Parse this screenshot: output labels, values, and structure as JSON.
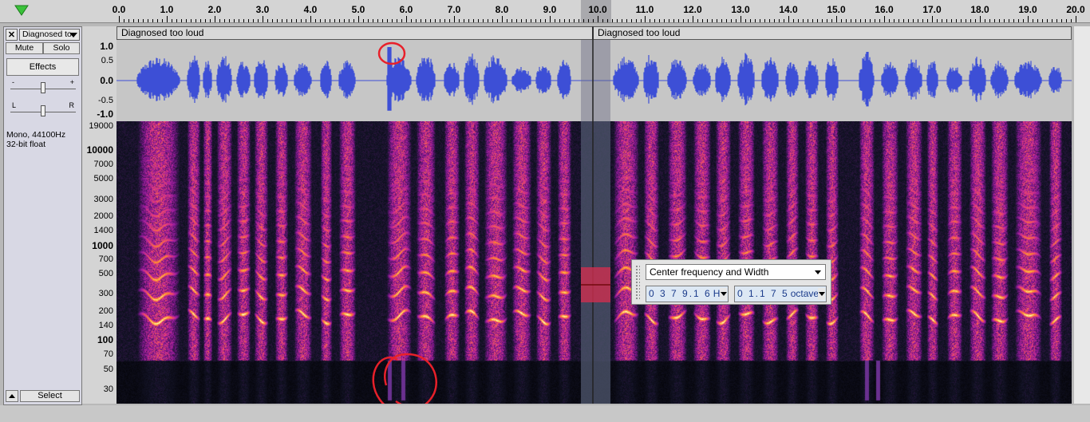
{
  "ruler": {
    "labels": [
      "0.0",
      "1.0",
      "2.0",
      "3.0",
      "4.0",
      "5.0",
      "6.0",
      "7.0",
      "8.0",
      "9.0",
      "10.0",
      "11.0",
      "12.0",
      "13.0",
      "14.0",
      "15.0",
      "16.0",
      "17.0",
      "18.0",
      "19.0",
      "20.0"
    ]
  },
  "track": {
    "close_glyph": "✕",
    "name": "Diagnosed to",
    "mute_label": "Mute",
    "solo_label": "Solo",
    "effects_label": "Effects",
    "gain_minus": "-",
    "gain_plus": "+",
    "pan_left": "L",
    "pan_right": "R",
    "format_line1": "Mono, 44100Hz",
    "format_line2": "32-bit float",
    "select_label": "Select",
    "gain_level": 0.5,
    "pan_level": 0.5
  },
  "waveform_scale": [
    "1.0",
    "0.5",
    "0.0",
    "-0.5",
    "-1.0"
  ],
  "spectrogram_scale": [
    "19000",
    "10000",
    "7000",
    "5000",
    "3000",
    "2000",
    "1400",
    "1000",
    "700",
    "500",
    "300",
    "200",
    "140",
    "100",
    "70",
    "50",
    "30"
  ],
  "clips": [
    {
      "name": "Diagnosed too loud"
    },
    {
      "name": "Diagnosed too loud"
    }
  ],
  "spectral_toolbar": {
    "preset": "Center frequency and Width",
    "center_value": "0 3 7 9.1 6",
    "center_unit": "Hz",
    "width_value": "0 1.1 7 5",
    "width_unit": "octaves"
  },
  "colors": {
    "waveform": "#3d4fd6",
    "annotation": "#e8202a",
    "selection": "#8a8aa0"
  },
  "icons": {
    "play_head": "green-down-triangle-icon",
    "track_menu": "chevron-down-icon",
    "collapse": "up-arrow-icon"
  }
}
